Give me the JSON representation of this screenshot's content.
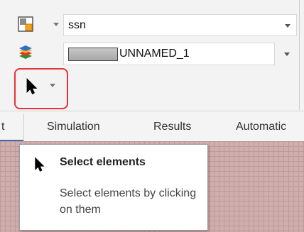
{
  "toolbar": {
    "view_mode_icon": "split-view-icon",
    "layers_icon": "layer-stack-icon",
    "select_tool_icon": "arrow-cursor-icon",
    "combo_top": {
      "value": "ssn"
    },
    "combo_material": {
      "value": "UNNAMED_1"
    }
  },
  "tabs": [
    {
      "label": "t"
    },
    {
      "label": "Simulation"
    },
    {
      "label": "Results"
    },
    {
      "label": "Automatic"
    }
  ],
  "tooltip": {
    "icon": "arrow-cursor-icon",
    "title": "Select elements",
    "description": "Select elements by clicking on them"
  },
  "colors": {
    "highlight": "#e5343a",
    "tab_accent": "#3b6db1",
    "canvas": "#cfaeae"
  }
}
